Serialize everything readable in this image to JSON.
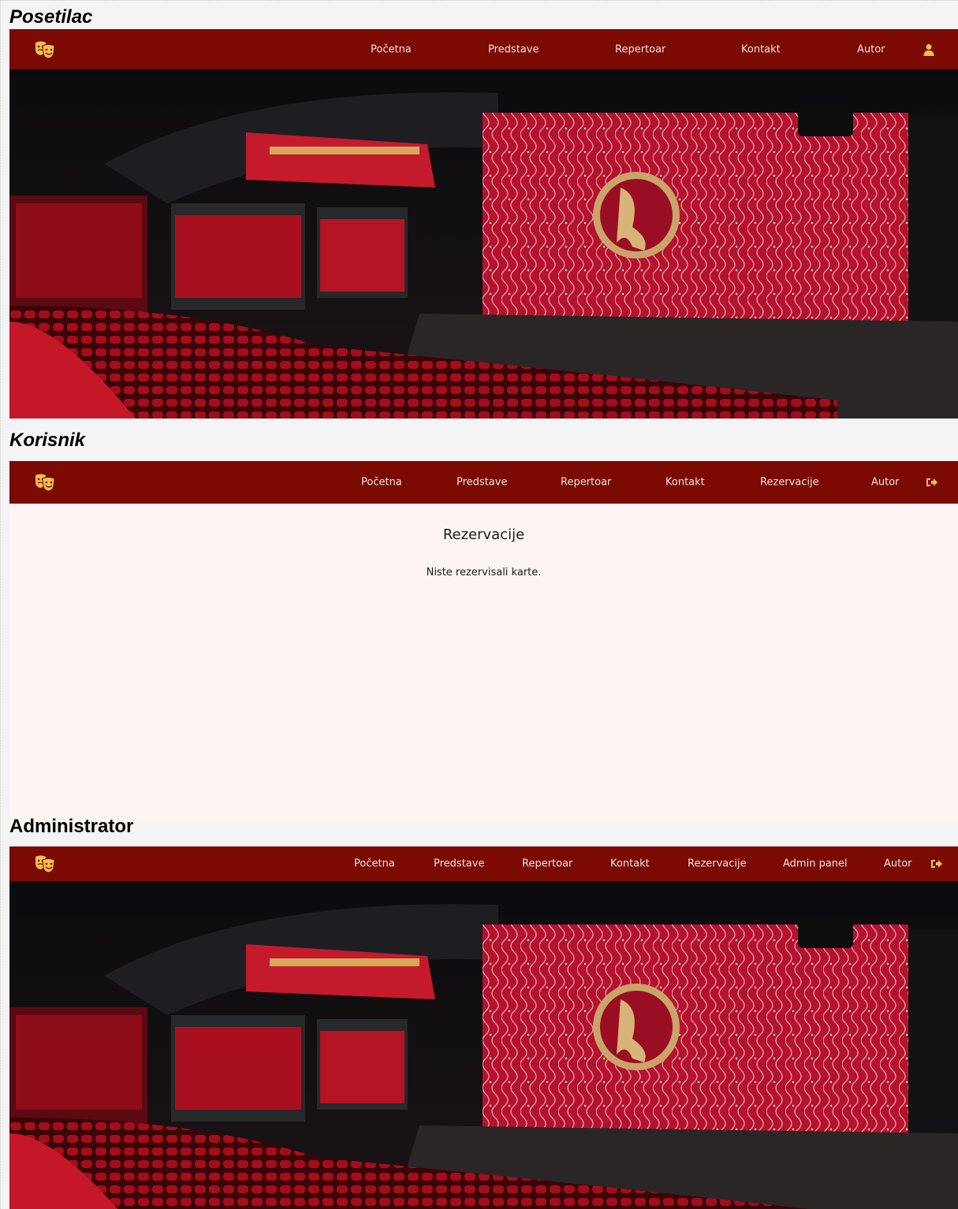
{
  "sections": {
    "visitor_title": "Posetilac",
    "user_title": "Korisnik",
    "admin_title": "Administrator"
  },
  "visitor_nav": {
    "items": [
      "Početna",
      "Predstave",
      "Repertoar",
      "Kontakt",
      "Autor"
    ],
    "right_icon": "user-icon"
  },
  "user_nav": {
    "items": [
      "Početna",
      "Predstave",
      "Repertoar",
      "Kontakt",
      "Rezervacije",
      "Autor"
    ],
    "right_icon": "logout-icon"
  },
  "admin_nav": {
    "items": [
      "Početna",
      "Predstave",
      "Repertoar",
      "Kontakt",
      "Rezervacije",
      "Admin panel",
      "Autor"
    ],
    "right_icon": "logout-icon"
  },
  "reservations": {
    "title": "Rezervacije",
    "message": "Niste rezervisali karte."
  },
  "colors": {
    "navbar": "#7a0a02",
    "icon_accent": "#f5c04a",
    "content_bg": "#fcf5f2"
  },
  "icons": {
    "logo": "theater-masks-icon"
  }
}
